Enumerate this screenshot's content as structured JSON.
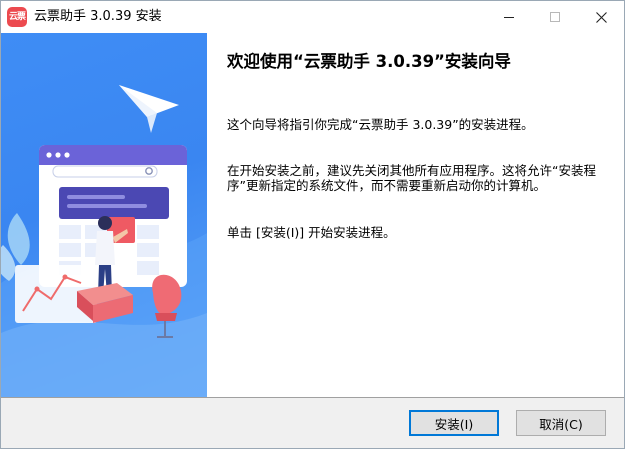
{
  "window": {
    "title": "云票助手 3.0.39 安装",
    "icon_text": "云票",
    "controls": {
      "minimize": "minimize-icon",
      "maximize": "maximize-icon",
      "close": "close-icon"
    }
  },
  "content": {
    "heading": "欢迎使用“云票助手 3.0.39”安装向导",
    "paragraphs": [
      "这个向导将指引你完成“云票助手 3.0.39”的安装进程。",
      "在开始安装之前，建议先关闭其他所有应用程序。这将允许“安装程序”更新指定的系统文件，而不需要重新启动你的计算机。",
      "单击 [安装(I)] 开始安装进程。"
    ]
  },
  "buttons": {
    "install": "安装(I)",
    "cancel": "取消(C)"
  },
  "colors": {
    "banner_blue": "#3f8df5",
    "accent_red": "#ec4a4f",
    "default_button_border": "#0078d7"
  }
}
